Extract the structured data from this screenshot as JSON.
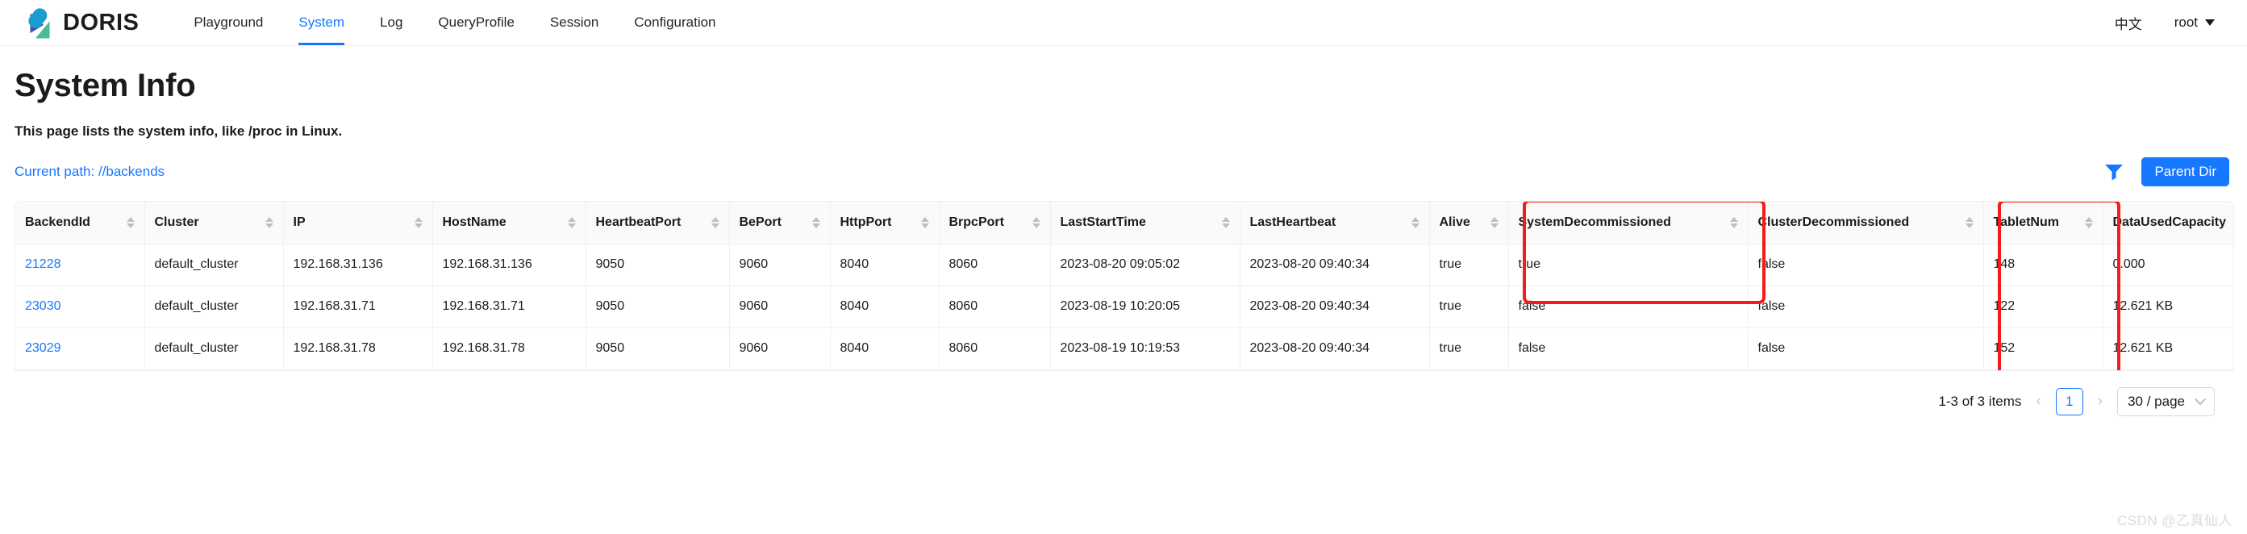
{
  "navbar": {
    "brand": "DORIS",
    "logo_icon": "doris-logo-icon",
    "items": [
      {
        "label": "Playground",
        "active": false
      },
      {
        "label": "System",
        "active": true
      },
      {
        "label": "Log",
        "active": false
      },
      {
        "label": "QueryProfile",
        "active": false
      },
      {
        "label": "Session",
        "active": false
      },
      {
        "label": "Configuration",
        "active": false
      }
    ],
    "language": "中文",
    "user": "root"
  },
  "page": {
    "title": "System Info",
    "description": "This page lists the system info, like /proc in Linux.",
    "current_path": "Current path: //backends",
    "filter_icon": "filter-icon",
    "parent_dir_label": "Parent Dir"
  },
  "table": {
    "columns": [
      "BackendId",
      "Cluster",
      "IP",
      "HostName",
      "HeartbeatPort",
      "BePort",
      "HttpPort",
      "BrpcPort",
      "LastStartTime",
      "LastHeartbeat",
      "Alive",
      "SystemDecommissioned",
      "ClusterDecommissioned",
      "TabletNum",
      "DataUsedCapacity"
    ],
    "rows": [
      {
        "BackendId": "21228",
        "Cluster": "default_cluster",
        "IP": "192.168.31.136",
        "HostName": "192.168.31.136",
        "HeartbeatPort": "9050",
        "BePort": "9060",
        "HttpPort": "8040",
        "BrpcPort": "8060",
        "LastStartTime": "2023-08-20 09:05:02",
        "LastHeartbeat": "2023-08-20 09:40:34",
        "Alive": "true",
        "SystemDecommissioned": "true",
        "ClusterDecommissioned": "false",
        "TabletNum": "148",
        "DataUsedCapacity": "0.000"
      },
      {
        "BackendId": "23030",
        "Cluster": "default_cluster",
        "IP": "192.168.31.71",
        "HostName": "192.168.31.71",
        "HeartbeatPort": "9050",
        "BePort": "9060",
        "HttpPort": "8040",
        "BrpcPort": "8060",
        "LastStartTime": "2023-08-19 10:20:05",
        "LastHeartbeat": "2023-08-20 09:40:34",
        "Alive": "true",
        "SystemDecommissioned": "false",
        "ClusterDecommissioned": "false",
        "TabletNum": "122",
        "DataUsedCapacity": "12.621 KB"
      },
      {
        "BackendId": "23029",
        "Cluster": "default_cluster",
        "IP": "192.168.31.78",
        "HostName": "192.168.31.78",
        "HeartbeatPort": "9050",
        "BePort": "9060",
        "HttpPort": "8040",
        "BrpcPort": "8060",
        "LastStartTime": "2023-08-19 10:19:53",
        "LastHeartbeat": "2023-08-20 09:40:34",
        "Alive": "true",
        "SystemDecommissioned": "false",
        "ClusterDecommissioned": "false",
        "TabletNum": "152",
        "DataUsedCapacity": "12.621 KB"
      }
    ]
  },
  "pagination": {
    "total_text": "1-3 of 3 items",
    "prev_icon": "chevron-left-icon",
    "next_icon": "chevron-right-icon",
    "current_page": "1",
    "page_size": "30 / page"
  },
  "annotations": {
    "highlight_color": "#f41b1b",
    "boxes": [
      {
        "column": "SystemDecommissioned"
      },
      {
        "column": "TabletNum"
      }
    ]
  },
  "watermark": "CSDN @乙真仙人"
}
